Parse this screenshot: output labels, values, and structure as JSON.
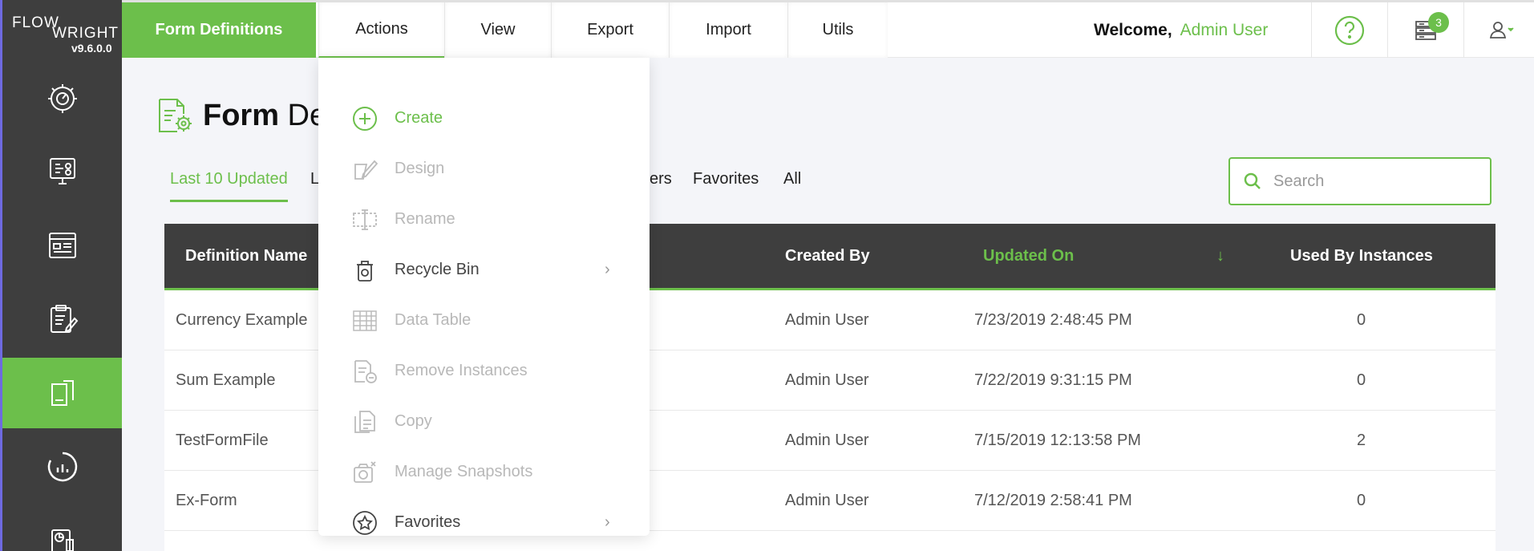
{
  "app": {
    "logo_line1": "FLOW",
    "logo_line2": "WRIGHT",
    "version": "v9.6.0.0"
  },
  "topbar": {
    "brand_tab": "Form Definitions",
    "menus": [
      "Actions",
      "View",
      "Export",
      "Import",
      "Utils"
    ],
    "welcome_label": "Welcome,",
    "user_name": "Admin User",
    "notification_count": "3"
  },
  "sidebar": {
    "items": [
      {
        "icon": "dashboard-gear-icon"
      },
      {
        "icon": "workflow-monitor-icon"
      },
      {
        "icon": "definitions-list-icon"
      },
      {
        "icon": "clipboard-edit-icon"
      },
      {
        "icon": "form-document-icon",
        "active": true
      },
      {
        "icon": "analytics-circle-icon"
      },
      {
        "icon": "reports-icon"
      }
    ]
  },
  "page": {
    "title_bold": "Form",
    "title_rest": " Definitions",
    "title_visible_rest": " De"
  },
  "filters": {
    "last10": "Last 10 Updated",
    "partial": "L",
    "partial2": "ers",
    "favorites": "Favorites",
    "all": "All"
  },
  "search": {
    "placeholder": "Search"
  },
  "table": {
    "headers": {
      "name": "Definition Name",
      "created_by": "Created By",
      "updated_on": "Updated On",
      "used_by": "Used By Instances"
    },
    "sort_indicator": "↓",
    "rows": [
      {
        "name": "Currency Example",
        "created_by": "Admin User",
        "updated_on": "7/23/2019 2:48:45 PM",
        "used_by": "0"
      },
      {
        "name": "Sum Example",
        "created_by": "Admin User",
        "updated_on": "7/22/2019 9:31:15 PM",
        "used_by": "0"
      },
      {
        "name": "TestFormFile",
        "created_by": "Admin User",
        "updated_on": "7/15/2019 12:13:58 PM",
        "used_by": "2"
      },
      {
        "name": "Ex-Form",
        "created_by": "Admin User",
        "updated_on": "7/12/2019 2:58:41 PM",
        "used_by": "0"
      }
    ]
  },
  "actions_menu": {
    "items": [
      {
        "label": "Create",
        "state": "primary",
        "icon": "plus-circle-icon"
      },
      {
        "label": "Design",
        "state": "disabled",
        "icon": "design-pencil-icon"
      },
      {
        "label": "Rename",
        "state": "disabled",
        "icon": "rename-cursor-icon"
      },
      {
        "label": "Recycle Bin",
        "state": "enabled",
        "icon": "recycle-bin-icon",
        "submenu": true
      },
      {
        "label": "Data Table",
        "state": "disabled",
        "icon": "table-grid-icon"
      },
      {
        "label": "Remove Instances",
        "state": "disabled",
        "icon": "remove-document-icon"
      },
      {
        "label": "Copy",
        "state": "disabled",
        "icon": "copy-document-icon"
      },
      {
        "label": "Manage Snapshots",
        "state": "disabled",
        "icon": "camera-icon"
      },
      {
        "label": "Favorites",
        "state": "enabled",
        "icon": "star-circle-icon",
        "submenu": true
      }
    ]
  },
  "colors": {
    "accent": "#6cbf4b",
    "sidebar": "#3e3e3e",
    "table_head": "#3e3e3e"
  }
}
